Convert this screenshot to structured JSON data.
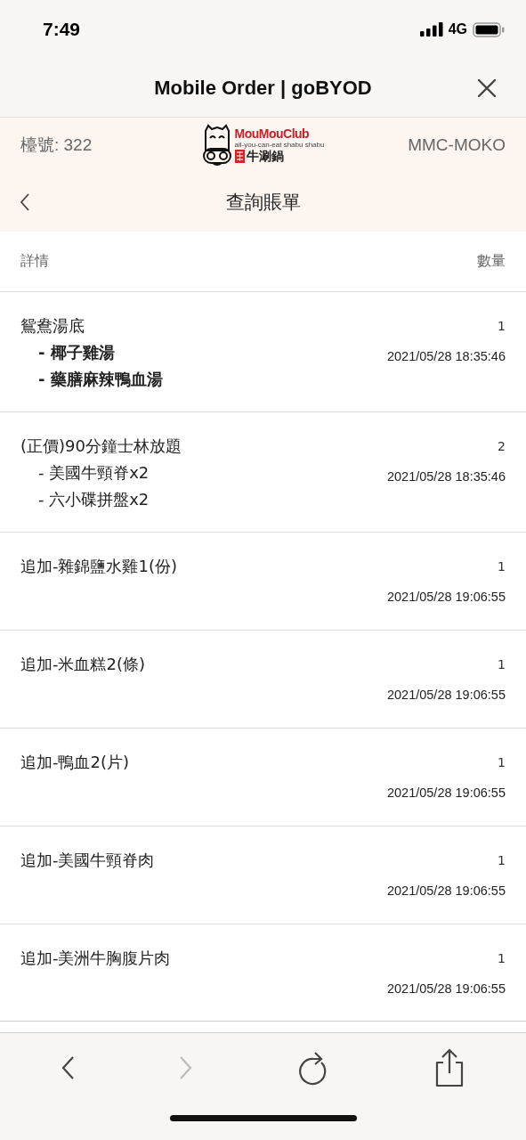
{
  "status_bar": {
    "time": "7:49",
    "network": "4G"
  },
  "browser": {
    "title": "Mobile Order | goBYOD"
  },
  "header": {
    "table_label": "檯號: 322",
    "logo": {
      "name": "MouMouClub",
      "tagline": "all-you-can-eat shabu shabu",
      "subtitle": "牛涮鍋"
    },
    "store_code": "MMC-MOKO",
    "page_title": "查詢賬單"
  },
  "columns": {
    "details": "詳情",
    "quantity": "數量"
  },
  "rows": [
    {
      "name": "鴛鴦湯底",
      "quantity": "1",
      "time": "2021/05/28 18:35:46",
      "options": [
        {
          "text": "- 椰子雞湯",
          "bold": true
        },
        {
          "text": "- 藥膳麻辣鴨血湯",
          "bold": true
        }
      ]
    },
    {
      "name": "(正價)90分鐘士林放題",
      "quantity": "2",
      "time": "2021/05/28 18:35:46",
      "options": [
        {
          "text": "- 美國牛頸脊x2",
          "bold": false
        },
        {
          "text": "- 六小碟拼盤x2",
          "bold": false
        }
      ]
    },
    {
      "name": "追加-雜錦鹽水雞1(份)",
      "quantity": "1",
      "time": "2021/05/28 19:06:55"
    },
    {
      "name": "追加-米血糕2(條)",
      "quantity": "1",
      "time": "2021/05/28 19:06:55"
    },
    {
      "name": "追加-鴨血2(片)",
      "quantity": "1",
      "time": "2021/05/28 19:06:55"
    },
    {
      "name": "追加-美國牛頸脊肉",
      "quantity": "1",
      "time": "2021/05/28 19:06:55"
    },
    {
      "name": "追加-美洲牛胸腹片肉",
      "quantity": "1",
      "time": "2021/05/28 19:06:55"
    }
  ],
  "toolbar": {
    "back_disabled": false,
    "forward_disabled": true
  }
}
